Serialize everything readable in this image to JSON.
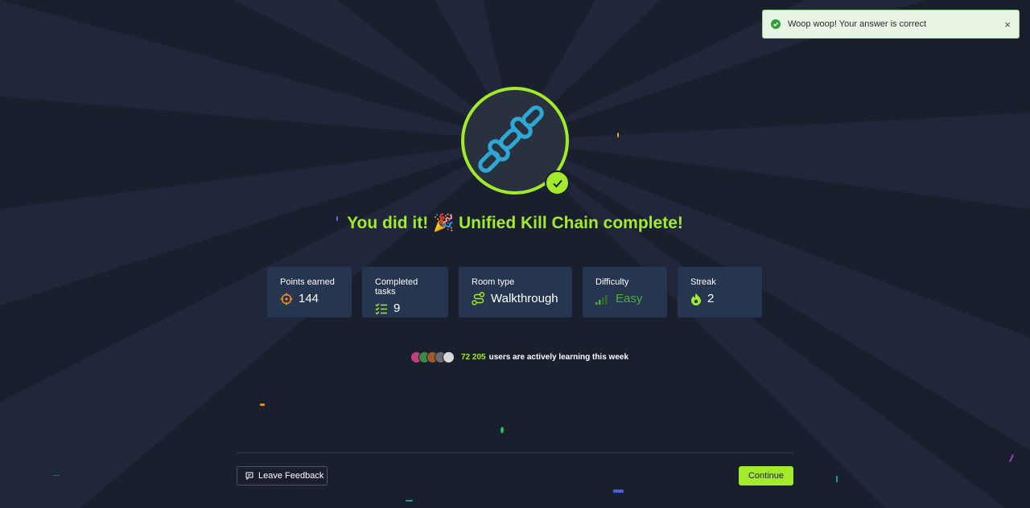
{
  "toast": {
    "message": "Woop woop! Your answer is correct",
    "close": "×"
  },
  "completion": {
    "title": "You did it! 🎉 Unified Kill Chain complete!"
  },
  "stats": [
    {
      "label": "Points earned",
      "value": "144",
      "icon": "target-icon"
    },
    {
      "label": "Completed tasks",
      "value": "9",
      "icon": "checklist-icon"
    },
    {
      "label": "Room type",
      "value": "Walkthrough",
      "icon": "route-icon"
    },
    {
      "label": "Difficulty",
      "value": "Easy",
      "icon": "signal-bars-icon"
    },
    {
      "label": "Streak",
      "value": "2",
      "icon": "flame-icon"
    }
  ],
  "community": {
    "count": "72 205",
    "text": "users are actively learning this week"
  },
  "footer": {
    "feedback_label": "Leave Feedback",
    "continue_label": "Continue"
  },
  "colors": {
    "accent": "#a3ea2a",
    "background": "#1a1f2e",
    "card": "#263550",
    "easy": "#4caf3c",
    "chain": "#2fa7d4"
  }
}
